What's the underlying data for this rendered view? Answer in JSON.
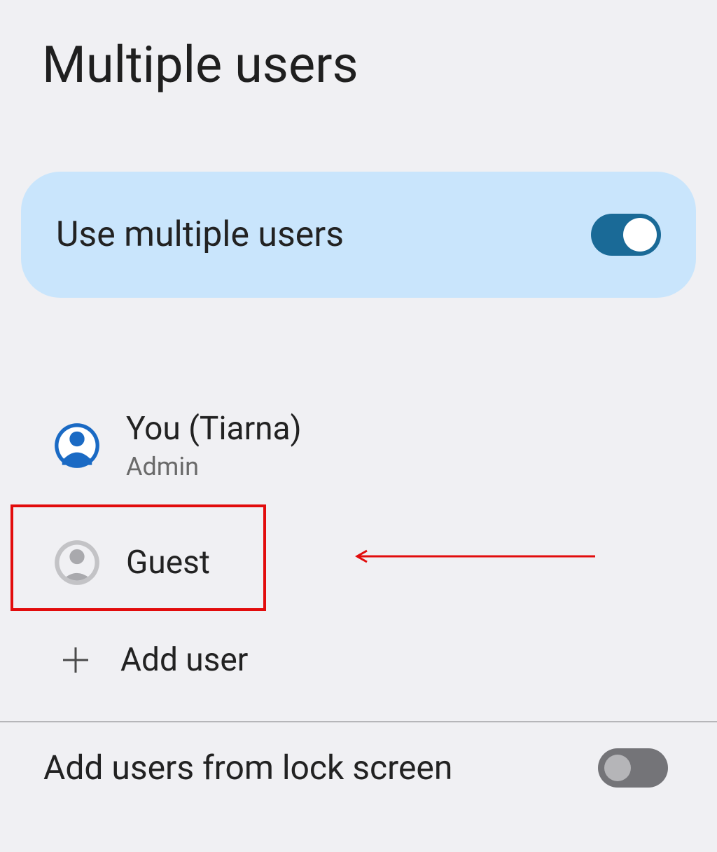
{
  "page": {
    "title": "Multiple users"
  },
  "toggle_card": {
    "label": "Use multiple users",
    "state": "on"
  },
  "users": {
    "current": {
      "name": "You (Tiarna)",
      "role": "Admin"
    },
    "guest": {
      "name": "Guest"
    }
  },
  "actions": {
    "add_user": "Add user"
  },
  "lock_screen": {
    "label": "Add users from lock screen",
    "state": "off"
  }
}
